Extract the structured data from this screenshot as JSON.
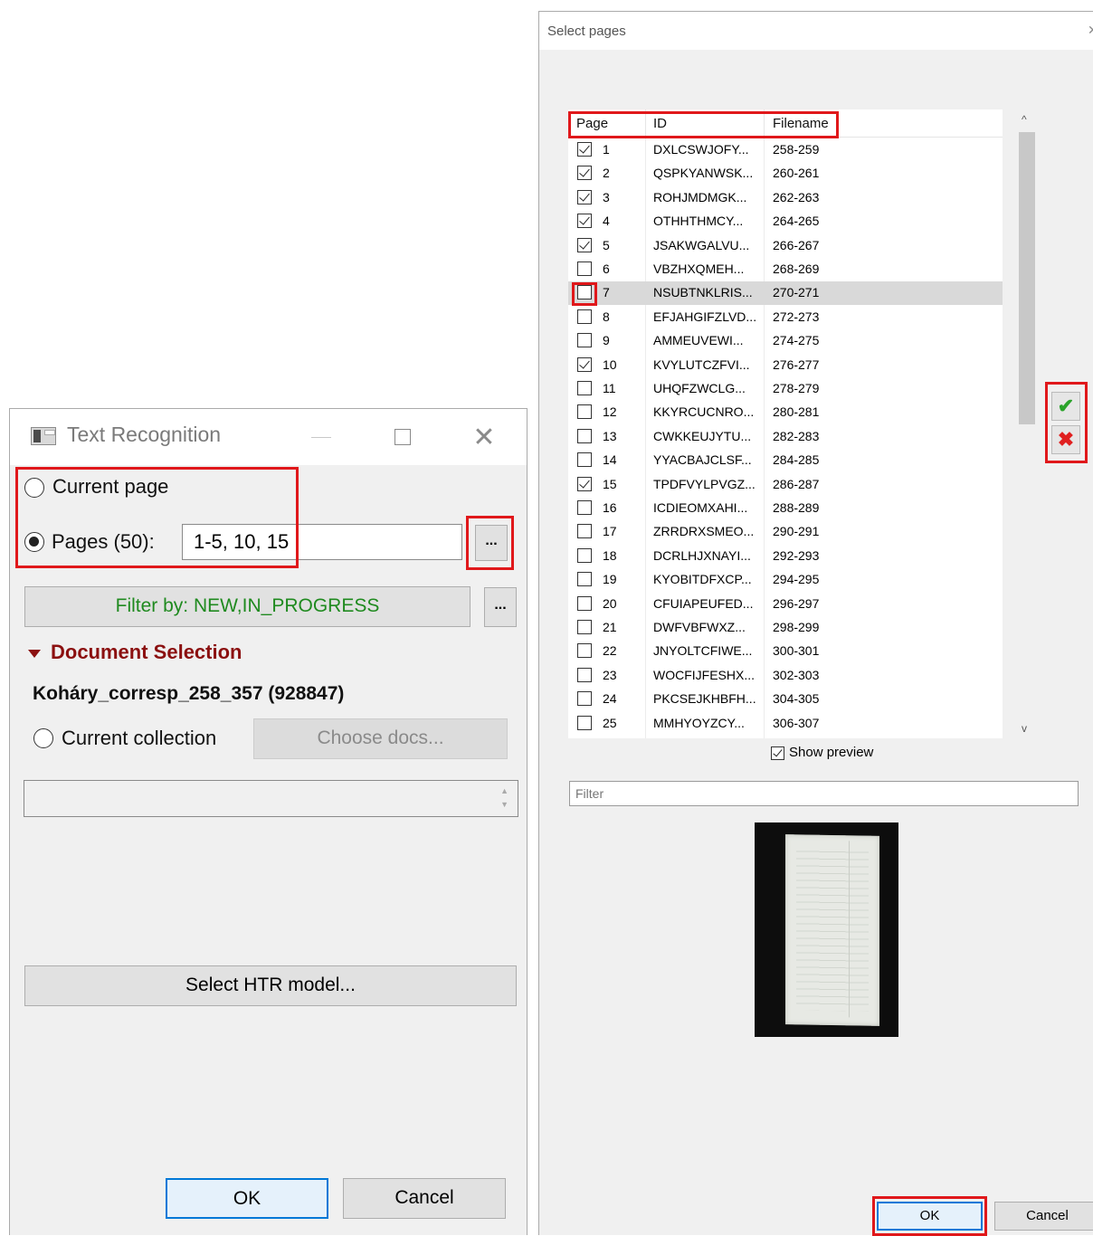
{
  "text_recognition": {
    "title": "Text Recognition",
    "current_page_label": "Current page",
    "pages_label": "Pages (50):",
    "pages_value": "1-5, 10, 15",
    "dots_label": "...",
    "filter_label": "Filter by: NEW,IN_PROGRESS",
    "document_selection_title": "Document Selection",
    "document_name": "Koháry_corresp_258_357 (928847)",
    "current_collection_label": "Current collection",
    "choose_docs_label": "Choose docs...",
    "select_htr_label": "Select HTR model...",
    "ok_label": "OK",
    "cancel_label": "Cancel",
    "selected_option": "pages"
  },
  "select_pages": {
    "title": "Select pages",
    "columns": [
      "Page",
      "ID",
      "Filename"
    ],
    "rows": [
      {
        "page": "1",
        "id": "DXLCSWJOFY...",
        "filename": "258-259",
        "checked": true
      },
      {
        "page": "2",
        "id": "QSPKYANWSK...",
        "filename": "260-261",
        "checked": true
      },
      {
        "page": "3",
        "id": "ROHJMDMGK...",
        "filename": "262-263",
        "checked": true
      },
      {
        "page": "4",
        "id": "OTHHTHMCY...",
        "filename": "264-265",
        "checked": true
      },
      {
        "page": "5",
        "id": "JSAKWGALVU...",
        "filename": "266-267",
        "checked": true
      },
      {
        "page": "6",
        "id": "VBZHXQMEH...",
        "filename": "268-269",
        "checked": false
      },
      {
        "page": "7",
        "id": "NSUBTNKLRIS...",
        "filename": "270-271",
        "checked": false,
        "selected": true
      },
      {
        "page": "8",
        "id": "EFJAHGIFZLVD...",
        "filename": "272-273",
        "checked": false
      },
      {
        "page": "9",
        "id": "AMMEUVEWI...",
        "filename": "274-275",
        "checked": false
      },
      {
        "page": "10",
        "id": "KVYLUTCZFVI...",
        "filename": "276-277",
        "checked": true
      },
      {
        "page": "11",
        "id": "UHQFZWCLG...",
        "filename": "278-279",
        "checked": false
      },
      {
        "page": "12",
        "id": "KKYRCUCNRO...",
        "filename": "280-281",
        "checked": false
      },
      {
        "page": "13",
        "id": "CWKKEUJYTU...",
        "filename": "282-283",
        "checked": false
      },
      {
        "page": "14",
        "id": "YYACBAJCLSF...",
        "filename": "284-285",
        "checked": false
      },
      {
        "page": "15",
        "id": "TPDFVYLPVGZ...",
        "filename": "286-287",
        "checked": true
      },
      {
        "page": "16",
        "id": "ICDIEOMXAHI...",
        "filename": "288-289",
        "checked": false
      },
      {
        "page": "17",
        "id": "ZRRDRXSMEO...",
        "filename": "290-291",
        "checked": false
      },
      {
        "page": "18",
        "id": "DCRLHJXNAYI...",
        "filename": "292-293",
        "checked": false
      },
      {
        "page": "19",
        "id": "KYOBITDFXCP...",
        "filename": "294-295",
        "checked": false
      },
      {
        "page": "20",
        "id": "CFUIAPEUFED...",
        "filename": "296-297",
        "checked": false
      },
      {
        "page": "21",
        "id": "DWFVBFWXZ...",
        "filename": "298-299",
        "checked": false
      },
      {
        "page": "22",
        "id": "JNYOLTCFIWE...",
        "filename": "300-301",
        "checked": false
      },
      {
        "page": "23",
        "id": "WOCFIJFESHX...",
        "filename": "302-303",
        "checked": false
      },
      {
        "page": "24",
        "id": "PKCSEJKHBFH...",
        "filename": "304-305",
        "checked": false
      },
      {
        "page": "25",
        "id": "MMHYOYZCY...",
        "filename": "306-307",
        "checked": false
      }
    ],
    "show_preview_label": "Show preview",
    "show_preview_checked": true,
    "filter_placeholder": "Filter",
    "ok_label": "OK",
    "cancel_label": "Cancel"
  },
  "colors": {
    "highlight_red": "#e0181b",
    "filter_green": "#1f8a1f",
    "section_dark_red": "#8b1010",
    "focus_blue": "#0078d7"
  }
}
